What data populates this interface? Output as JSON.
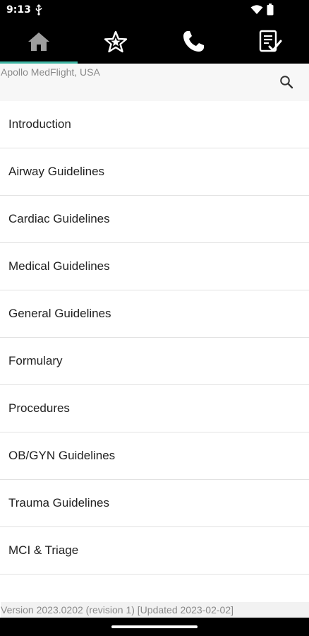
{
  "status_bar": {
    "time": "9:13"
  },
  "tabs": [
    {
      "name": "home",
      "icon": "home-icon"
    },
    {
      "name": "favorites",
      "icon": "star-icon"
    },
    {
      "name": "contacts",
      "icon": "phone-icon"
    },
    {
      "name": "checklist",
      "icon": "checklist-icon"
    }
  ],
  "header": {
    "agency": "Apollo MedFlight, USA",
    "search_icon": "search-icon"
  },
  "menu": [
    "Introduction",
    "Airway Guidelines",
    "Cardiac Guidelines",
    "Medical Guidelines",
    "General Guidelines",
    "Formulary",
    "Procedures",
    "OB/GYN Guidelines",
    "Trauma Guidelines",
    "MCI & Triage"
  ],
  "footer": {
    "version": "Version 2023.0202 (revision 1) [Updated 2023-02-02]"
  },
  "colors": {
    "accent": "#3fb5a3",
    "bar_background": "#000000",
    "header_background": "#f7f7f7"
  }
}
